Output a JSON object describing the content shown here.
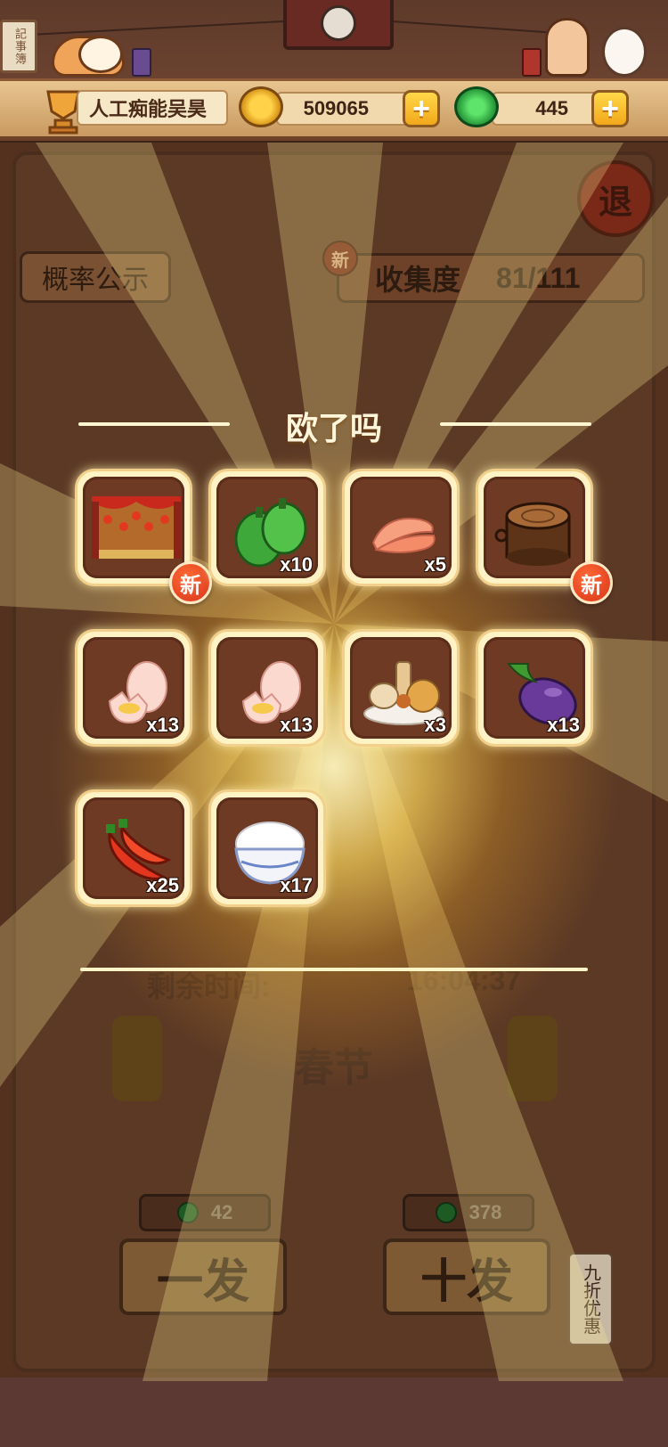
{
  "header": {
    "calendar_sign": "記事簿",
    "player_name": "人工痴能吴昊",
    "coins": "509065",
    "gems": "445"
  },
  "background": {
    "probability_button": "概率公示",
    "new_badge": "新",
    "collection_label": "收集度",
    "collection_value": "81/111",
    "exit_button": "退",
    "remaining_time_label": "剩余时间:",
    "remaining_time_value": "16:04:37",
    "season": "春节",
    "single_cost": "42",
    "ten_cost": "378",
    "single_draw": "一发",
    "ten_draw": "十发",
    "discount_tag": "九折优惠"
  },
  "result": {
    "title": "欧了吗",
    "items": [
      {
        "name": "festival-stage",
        "qty": "",
        "new": true
      },
      {
        "name": "green-pepper",
        "qty": "x10",
        "new": false
      },
      {
        "name": "salmon-slice",
        "qty": "x5",
        "new": false
      },
      {
        "name": "wood-stump",
        "qty": "",
        "new": true
      },
      {
        "name": "egg",
        "qty": "x13",
        "new": false
      },
      {
        "name": "egg",
        "qty": "x13",
        "new": false
      },
      {
        "name": "fried-snack-platter",
        "qty": "x3",
        "new": false
      },
      {
        "name": "eggplant",
        "qty": "x13",
        "new": false
      },
      {
        "name": "red-chili",
        "qty": "x25",
        "new": false
      },
      {
        "name": "rice-bowl",
        "qty": "x17",
        "new": false
      }
    ],
    "new_label": "新"
  },
  "colors": {
    "accent_gold": "#f2a81a",
    "badge_red": "#d9341a",
    "panel_brown": "#6e3a24"
  }
}
